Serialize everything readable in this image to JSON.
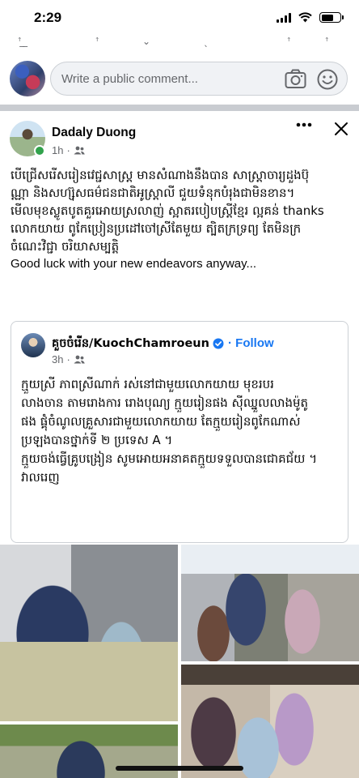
{
  "status_bar": {
    "time": "2:29"
  },
  "comment_bar": {
    "placeholder": "Write a public comment..."
  },
  "post": {
    "author": "Dadaly Duong",
    "time": "1h",
    "lines": [
      "បើជ្រើសរើសរៀនវេជ្ជសាស្ត្រ មានសំណាងនឹងបាន សាស្រ្តាចារ្យដួងប៊ុ",
      "ណ្ណា និងសហ្ស៊ុសធម៌ជនជាតិអូស្ត្រាលី ជួយទំនុកបំរុងជាមិនខាន។",
      "មើលមុខស្លូតបូតគួរអោយស្រលាញ់ ស្អាតរបៀបស្រ្តីខ្មែរ ល្អគន់ thanks",
      "លោកយាយ ពូកែប្រៀនប្រដៅចៅស្រីតែមួយ ត្បិតក្រទ្រព្យ តែមិនក្រ",
      "ចំណេះវិជ្ជា ចរិយាសម្បត្តិ"
    ],
    "english_line": "Good luck with your new endeavors anyway..."
  },
  "shared": {
    "author": "គួចចំរើន/KuochChamroeun",
    "follow_label": "· Follow",
    "time": "3h",
    "lines": [
      "ក្មួយស្រី ភាពស្រីណាក់ រស់នៅជាមួយលោកយាយ មុខរបរ",
      "លាងចាន តាមរោងការ រោងបុណ្យ ក្មួយរៀនផង ស៊ីឈ្នួលលាងម៉ូតូ",
      "ផង ផ្គុំចំណូលគ្រួសារជាមួយលោកយាយ តែក្មួយរៀនពូកែណាស់",
      "ប្រឡងបានថ្នាក់ទី ២ ប្រទេស A ។",
      "ក្មួយចង់ធ្វើគ្រូបង្រៀន សូមអោយអនាគតក្មួយទទួលបានជោគជ័យ ។",
      "វាលរេញ"
    ]
  },
  "colors": {
    "accent": "#1877f2",
    "online": "#31a24c",
    "divider": "#c9ccd1"
  },
  "icons": [
    "camera-icon",
    "emoji-icon",
    "more-icon",
    "close-icon",
    "friends-icon",
    "verified-icon"
  ]
}
